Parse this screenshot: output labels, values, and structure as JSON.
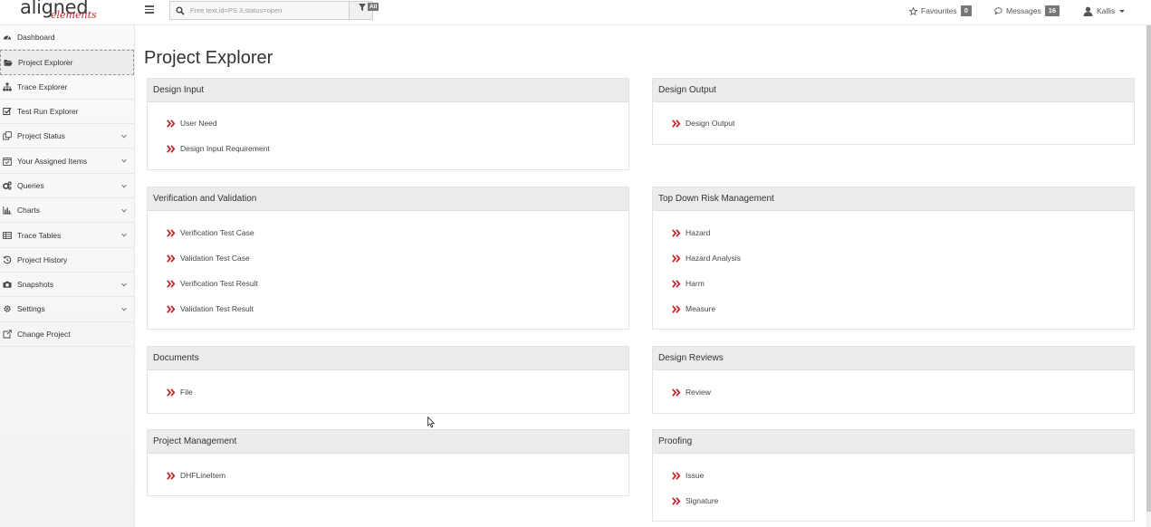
{
  "app": {
    "logo_main": "aligned",
    "logo_sub": "elements"
  },
  "topbar": {
    "search_placeholder": "Free text,id=PS 3,status=open",
    "filter_badge": "All",
    "favourites_label": "Favourites",
    "favourites_count": "0",
    "messages_label": "Messages",
    "messages_count": "16",
    "user_name": "Kallis"
  },
  "sidebar": {
    "items": [
      {
        "label": "Dashboard",
        "icon": "dashboard-icon",
        "expandable": false
      },
      {
        "label": "Project Explorer",
        "icon": "folder-open-icon",
        "expandable": false,
        "active": true
      },
      {
        "label": "Trace Explorer",
        "icon": "sitemap-icon",
        "expandable": false
      },
      {
        "label": "Test Run Explorer",
        "icon": "check-square-icon",
        "expandable": false
      },
      {
        "label": "Project Status",
        "icon": "clone-icon",
        "expandable": true
      },
      {
        "label": "Your Assigned Items",
        "icon": "calendar-check-icon",
        "expandable": true
      },
      {
        "label": "Queries",
        "icon": "cogs-icon",
        "expandable": true
      },
      {
        "label": "Charts",
        "icon": "bar-chart-icon",
        "expandable": true
      },
      {
        "label": "Trace Tables",
        "icon": "table-icon",
        "expandable": true
      },
      {
        "label": "Project History",
        "icon": "history-icon",
        "expandable": false
      },
      {
        "label": "Snapshots",
        "icon": "camera-icon",
        "expandable": true
      },
      {
        "label": "Settings",
        "icon": "gear-icon",
        "expandable": true
      },
      {
        "label": "Change Project",
        "icon": "external-link-icon",
        "expandable": false
      }
    ]
  },
  "main": {
    "title": "Project Explorer",
    "panels": [
      {
        "title": "Design Input",
        "items": [
          "User Need",
          "Design Input Requirement"
        ]
      },
      {
        "title": "Design Output",
        "items": [
          "Design Output"
        ]
      },
      {
        "title": "Verification and Validation",
        "items": [
          "Verification Test Case",
          "Validation Test Case",
          "Verification Test Result",
          "Validation Test Result"
        ]
      },
      {
        "title": "Top Down Risk Management",
        "items": [
          "Hazard",
          "Hazard Analysis",
          "Harm",
          "Measure"
        ]
      },
      {
        "title": "Documents",
        "items": [
          "File"
        ]
      },
      {
        "title": "Design Reviews",
        "items": [
          "Review"
        ]
      },
      {
        "title": "Project Management",
        "items": [
          "DHFLineItem"
        ]
      },
      {
        "title": "Proofing",
        "items": [
          "Issue",
          "Signature"
        ]
      }
    ]
  },
  "colors": {
    "accent_red": "#c1272d",
    "panel_header": "#ececec",
    "badge_gray": "#777777"
  }
}
